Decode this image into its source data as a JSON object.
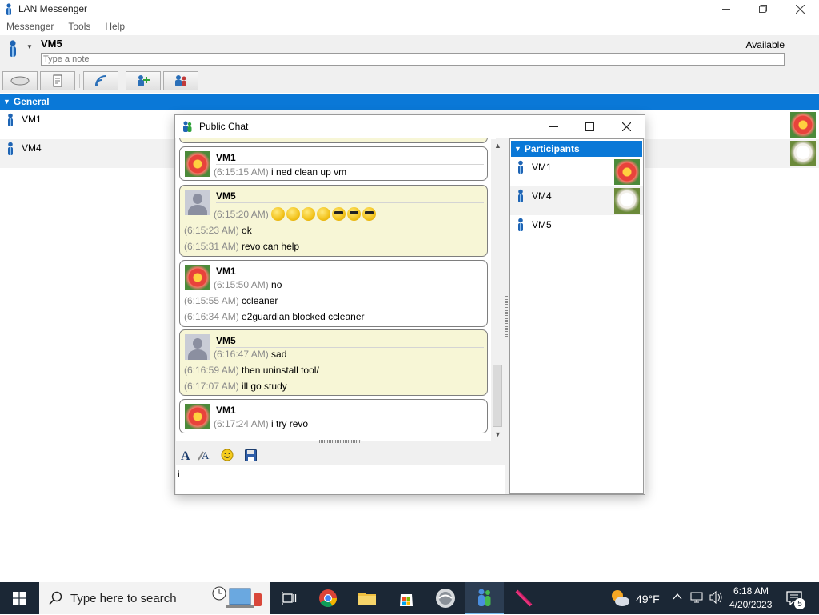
{
  "main_window": {
    "title": "LAN Messenger",
    "menu": [
      "Messenger",
      "Tools",
      "Help"
    ],
    "user_name": "VM5",
    "status": "Available",
    "note_placeholder": "Type a note",
    "group_name": "General",
    "contacts": [
      {
        "name": "VM1"
      },
      {
        "name": "VM4"
      }
    ]
  },
  "chat_window": {
    "title": "Public Chat",
    "messages": [
      {
        "sender": "VM1",
        "lines": [
          {
            "ts": "(6:15:15 AM)",
            "text": "i ned clean up vm"
          }
        ]
      },
      {
        "sender": "VM5",
        "lines": [
          {
            "ts": "(6:15:20 AM)",
            "text": ""
          },
          {
            "ts": "(6:15:23 AM)",
            "text": "ok"
          },
          {
            "ts": "(6:15:31 AM)",
            "text": "revo can help"
          }
        ]
      },
      {
        "sender": "VM1",
        "lines": [
          {
            "ts": "(6:15:50 AM)",
            "text": "no"
          },
          {
            "ts": "(6:15:55 AM)",
            "text": "ccleaner"
          },
          {
            "ts": "(6:16:34 AM)",
            "text": "e2guardian blocked ccleaner"
          }
        ]
      },
      {
        "sender": "VM5",
        "lines": [
          {
            "ts": "(6:16:47 AM)",
            "text": "sad"
          },
          {
            "ts": "(6:16:59 AM)",
            "text": "then uninstall tool/"
          },
          {
            "ts": "(6:17:07 AM)",
            "text": "ill go study"
          }
        ]
      },
      {
        "sender": "VM1",
        "lines": [
          {
            "ts": "(6:17:24 AM)",
            "text": "i try revo"
          }
        ]
      }
    ],
    "input_value": "i",
    "participants_header": "Participants",
    "participants": [
      {
        "name": "VM1"
      },
      {
        "name": "VM4"
      },
      {
        "name": "VM5"
      }
    ]
  },
  "taskbar": {
    "search_placeholder": "Type here to search",
    "weather_temp": "49°F",
    "time": "6:18 AM",
    "date": "4/20/2023",
    "notification_count": "5"
  },
  "colors": {
    "accent_blue": "#0a78d7",
    "vm5_bubble": "#f7f6d6",
    "taskbar": "#1b2735"
  }
}
